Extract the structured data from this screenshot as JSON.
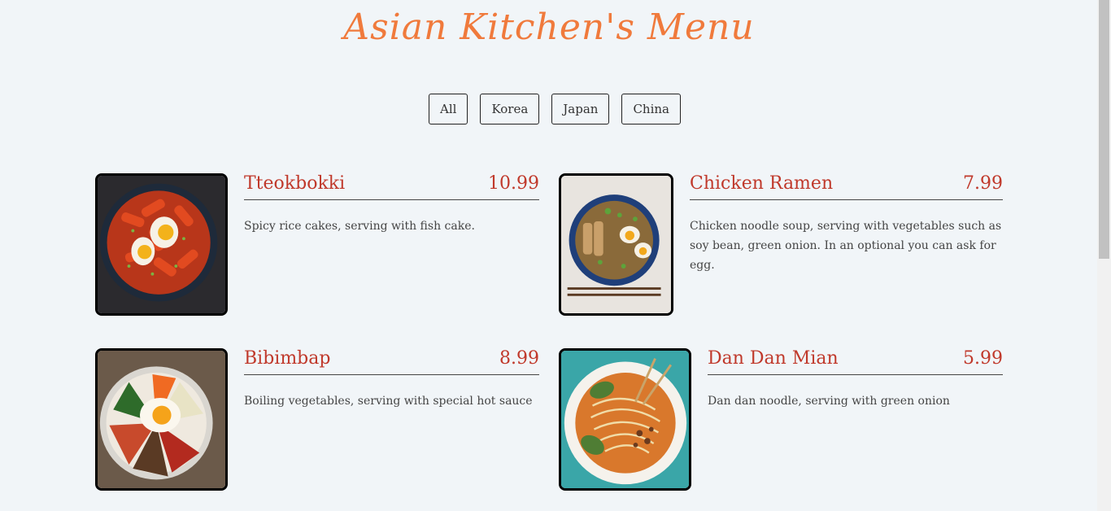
{
  "title": "Asian Kitchen's Menu",
  "filters": [
    "All",
    "Korea",
    "Japan",
    "China"
  ],
  "menu": [
    {
      "name": "Tteokbokki",
      "price": "10.99",
      "desc": "Spicy rice cakes, serving with fish cake.",
      "photo": "tteokbokki-photo"
    },
    {
      "name": "Chicken Ramen",
      "price": "7.99",
      "desc": "Chicken noodle soup, serving with vegetables such as soy bean, green onion. In an optional you can ask for egg.",
      "photo": "chicken-ramen-photo"
    },
    {
      "name": "Bibimbap",
      "price": "8.99",
      "desc": "Boiling vegetables, serving with special hot sauce",
      "photo": "bibimbap-photo"
    },
    {
      "name": "Dan Dan Mian",
      "price": "5.99",
      "desc": "Dan dan noodle, serving with green onion",
      "photo": "dan-dan-mian-photo"
    }
  ],
  "colors": {
    "title": "#f07a3c",
    "accent": "#c0392b",
    "background": "#f1f5f8"
  }
}
